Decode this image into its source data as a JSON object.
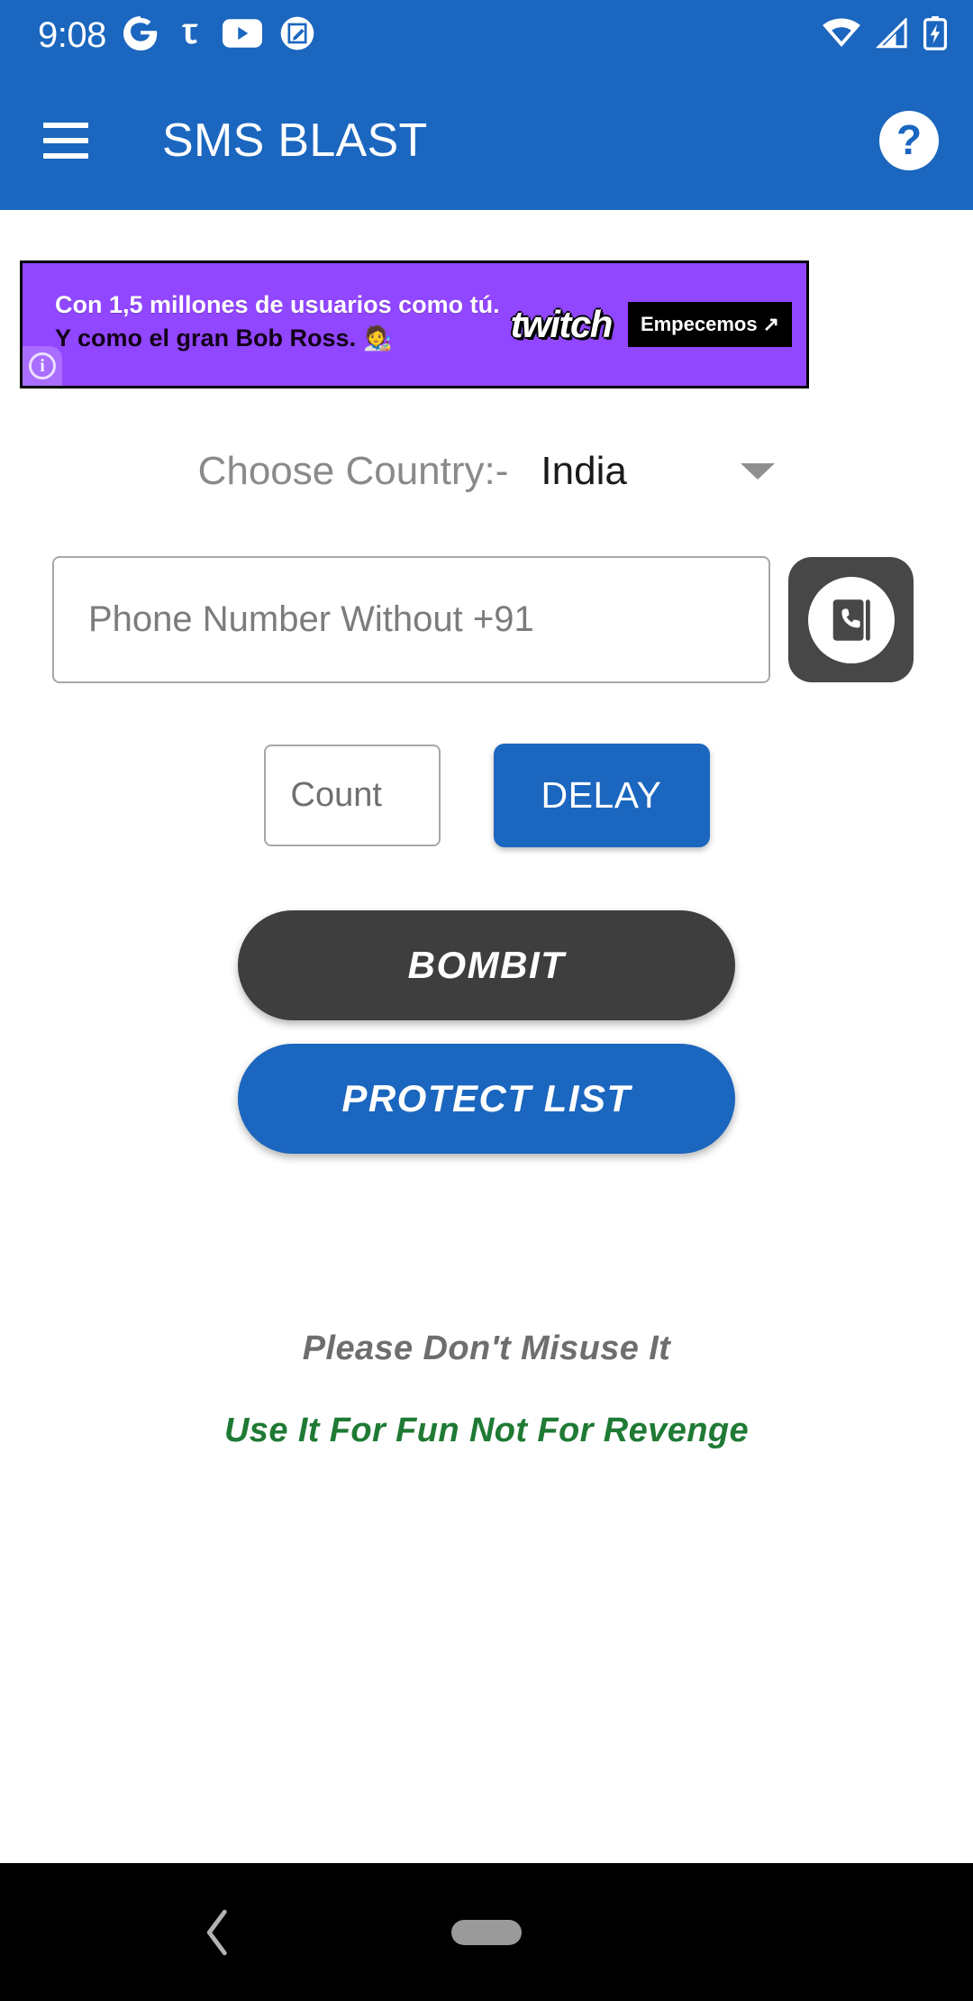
{
  "status_bar": {
    "time": "9:08",
    "left_icons": [
      {
        "name": "google-icon",
        "label": "G"
      },
      {
        "name": "tumblr-icon",
        "label": "T"
      },
      {
        "name": "youtube-icon",
        "label": "YouTube"
      },
      {
        "name": "screenshot-editor-icon",
        "label": "Screenshot"
      }
    ],
    "right_icons": [
      {
        "name": "wifi-icon",
        "label": "Wi-Fi"
      },
      {
        "name": "cellular-signal-icon",
        "label": "Signal"
      },
      {
        "name": "battery-charging-icon",
        "label": "Battery charging"
      }
    ]
  },
  "app_bar": {
    "menu_label": "Menu",
    "title": "SMS BLAST",
    "help_label": "?"
  },
  "ad": {
    "line1": "Con 1,5 millones de usuarios como tú.",
    "line2": "Y como el gran Bob Ross.",
    "emoji": "🧑‍🎨",
    "brand": "twitch",
    "cta": "Empecemos",
    "cta_arrow": "↗",
    "info_glyph": "i"
  },
  "form": {
    "country_label": "Choose Country:-",
    "country_value": "India",
    "country_options": [
      "India"
    ],
    "phone_placeholder": "Phone Number Without +91",
    "phone_value": "",
    "contacts_button_label": "Pick contact",
    "count_placeholder": "Count",
    "count_value": "",
    "delay_label": "DELAY",
    "bombit_label": "BOMBIT",
    "protect_list_label": "PROTECT LIST"
  },
  "notes": {
    "warning": "Please Don't Misuse It",
    "tagline": "Use It For Fun Not For Revenge"
  },
  "nav_bar": {
    "back_label": "Back",
    "home_label": "Home"
  },
  "colors": {
    "primary_blue": "#1b66bf",
    "dark_button": "#3e3e3e",
    "ad_purple": "#9146ff",
    "note_gray": "#6e6e6e",
    "note_green": "#1f7a34",
    "page_background": "#ffffff",
    "nav_background": "#000000"
  }
}
